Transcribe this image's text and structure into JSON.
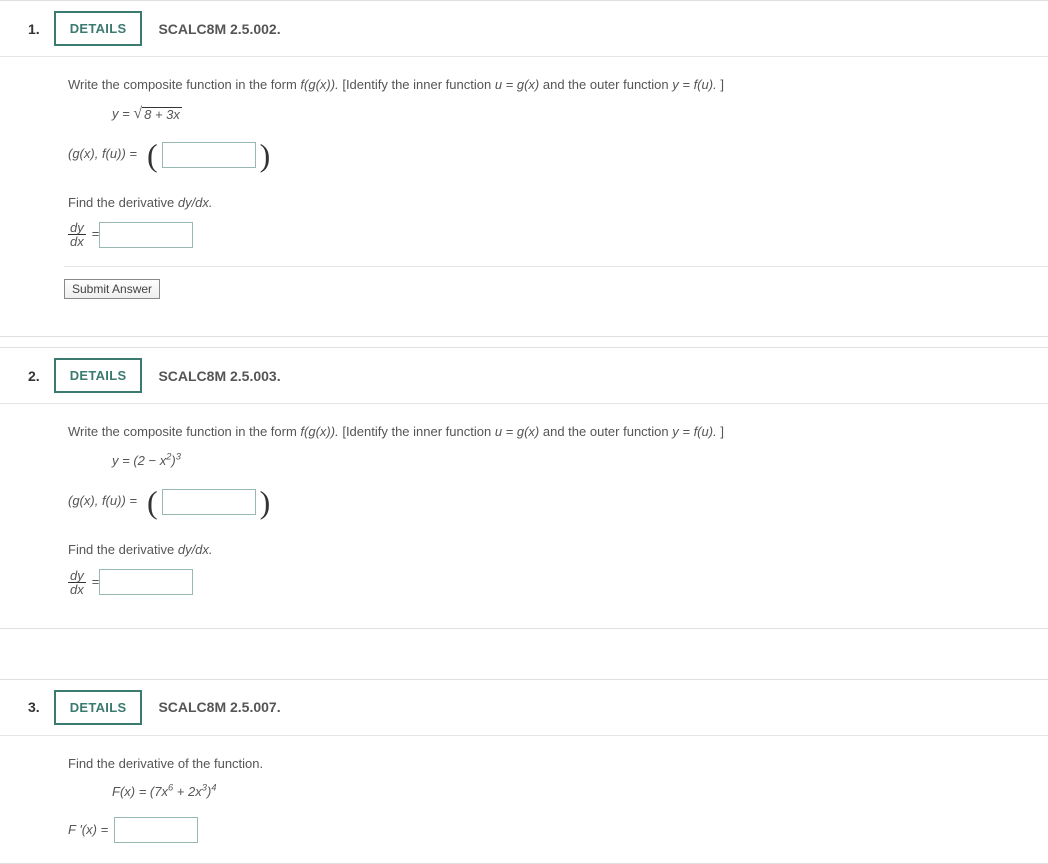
{
  "buttons": {
    "details": "DETAILS",
    "submit": "Submit Answer"
  },
  "questions": {
    "q1": {
      "number": "1.",
      "ref": "SCALC8M 2.5.002.",
      "prompt_a": "Write the composite function in the form  ",
      "prompt_fg": "f(g(x)).",
      "prompt_b": "  [Identify the inner function  ",
      "prompt_ug": "u = g(x)",
      "prompt_c": "  and the outer function  ",
      "prompt_yf": "y = f(u).",
      "prompt_d": "]",
      "eq_lhs": "y = ",
      "eq_radicand": "8 + 3x",
      "pair_lhs": "(g(x), f(u)) = ",
      "deriv_prompt": "Find the derivative ",
      "deriv_sym": "dy/dx.",
      "frac_num": "dy",
      "frac_den": "dx",
      "equals": " = "
    },
    "q2": {
      "number": "2.",
      "ref": "SCALC8M 2.5.003.",
      "prompt_a": "Write the composite function in the form  ",
      "prompt_fg": "f(g(x)).",
      "prompt_b": "  [Identify the inner function  ",
      "prompt_ug": "u = g(x)",
      "prompt_c": "  and the outer function  ",
      "prompt_yf": "y = f(u).",
      "prompt_d": "]",
      "eq_lhs": "y = ",
      "eq_base_a": "(2 − x",
      "eq_sup1": "2",
      "eq_base_b": ")",
      "eq_sup2": "3",
      "pair_lhs": "(g(x), f(u)) = ",
      "deriv_prompt": "Find the derivative ",
      "deriv_sym": "dy/dx.",
      "frac_num": "dy",
      "frac_den": "dx",
      "equals": " = "
    },
    "q3": {
      "number": "3.",
      "ref": "SCALC8M 2.5.007.",
      "prompt": "Find the derivative of the function.",
      "eq_lhs": "F(x) = ",
      "eq_a": "(7x",
      "eq_s1": "6",
      "eq_b": " + 2x",
      "eq_s2": "3",
      "eq_c": ")",
      "eq_s3": "4",
      "ans_lhs": "F '(x) = "
    }
  }
}
